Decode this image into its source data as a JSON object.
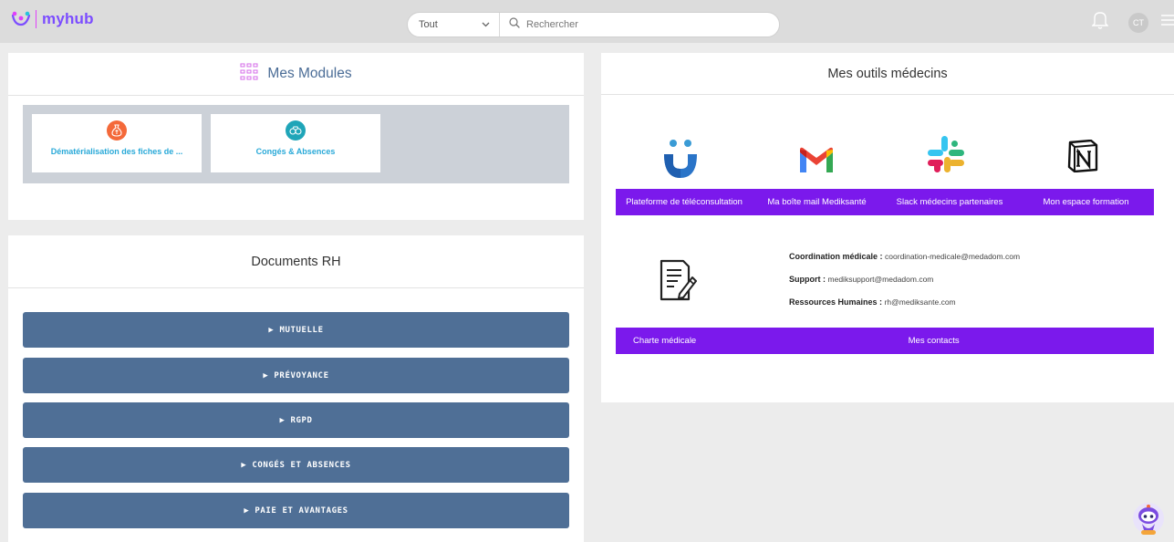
{
  "app": {
    "logo_text": "myhub"
  },
  "search": {
    "scope_value": "Tout",
    "placeholder": "Rechercher"
  },
  "user": {
    "initials": "CT"
  },
  "modules": {
    "title": "Mes Modules",
    "items": [
      {
        "label": "Dématérialisation des fiches de ...",
        "icon": "money-bag-icon",
        "color": "#f4693a"
      },
      {
        "label": "Congés & Absences",
        "icon": "binoculars-icon",
        "color": "#1fa5b8"
      }
    ]
  },
  "documents": {
    "title": "Documents RH",
    "items": [
      {
        "label": "▶ MUTUELLE"
      },
      {
        "label": "▶ PRÉVOYANCE"
      },
      {
        "label": "▶ RGPD"
      },
      {
        "label": "▶ CONGÉS ET ABSENCES"
      },
      {
        "label": "▶ PAIE ET AVANTAGES"
      }
    ]
  },
  "tools": {
    "title": "Mes outils médecins",
    "items": [
      {
        "label": "Plateforme de téléconsultation",
        "icon": "teleconsultation-logo-icon"
      },
      {
        "label": "Ma boîte mail Mediksanté",
        "icon": "gmail-icon"
      },
      {
        "label": "Slack médecins partenaires",
        "icon": "slack-icon"
      },
      {
        "label": "Mon espace formation",
        "icon": "notion-icon"
      }
    ],
    "contacts": [
      {
        "label": "Coordination médicale :",
        "value": "coordination-medicale@medadom.com"
      },
      {
        "label": "Support :",
        "value": "mediksupport@medadom.com"
      },
      {
        "label": "Ressources Humaines :",
        "value": "rh@mediksante.com"
      }
    ],
    "charte_label": "Charte médicale",
    "contacts_label": "Mes contacts"
  },
  "colors": {
    "accent_purple": "#7b19ec",
    "doc_button": "#4f6f96",
    "module_bg": "#ccd1d8"
  }
}
